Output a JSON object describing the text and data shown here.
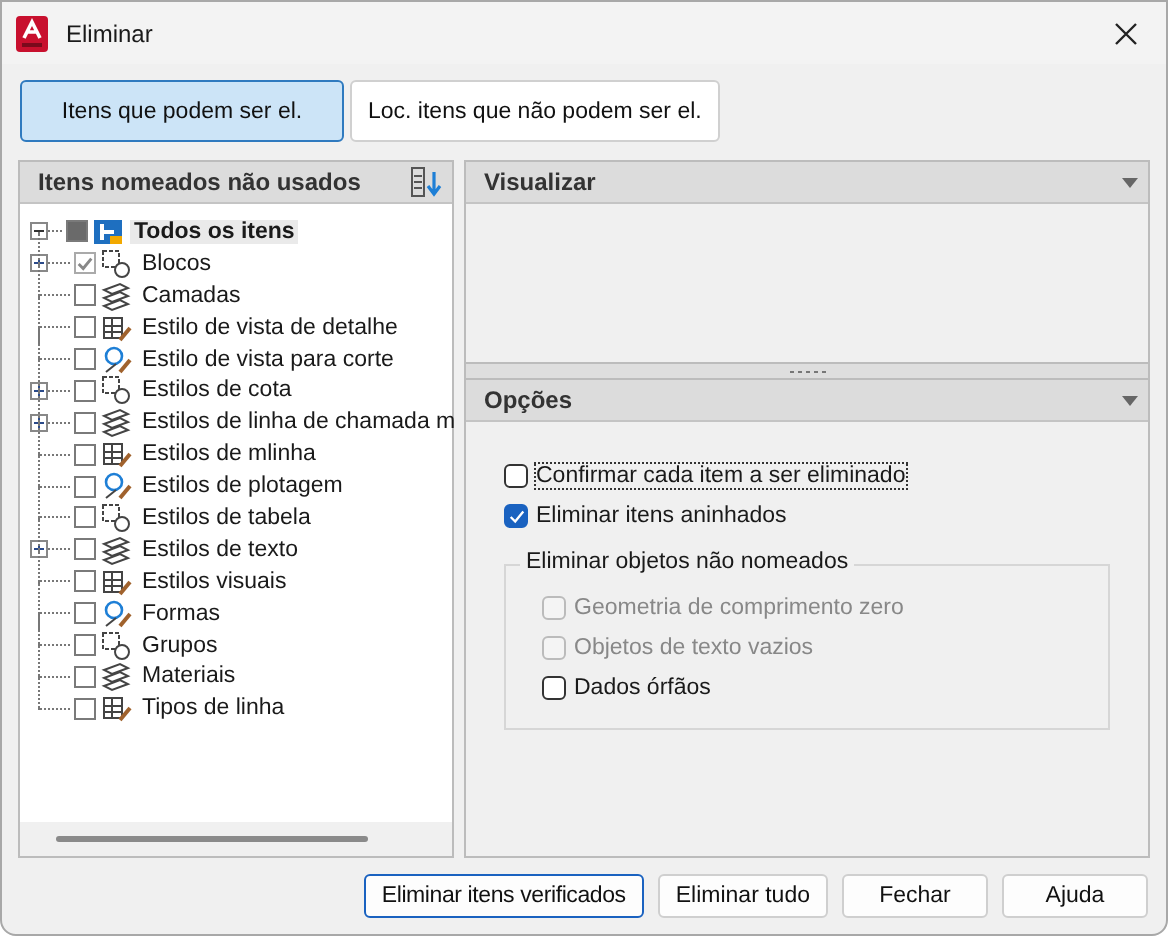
{
  "window": {
    "title": "Eliminar"
  },
  "tabs": [
    {
      "label": "Itens que podem ser el.",
      "selected": true
    },
    {
      "label": "Loc. itens que não podem ser el.",
      "selected": false
    }
  ],
  "tree": {
    "title": "Itens nomeados não usados",
    "root": {
      "label": "Todos os itens",
      "expanded": true,
      "indeterminate": true,
      "selected": true,
      "children": [
        {
          "label": "Blocos",
          "selected": false,
          "checked": true,
          "disabled": true,
          "expandable": true
        },
        {
          "label": "Camadas",
          "selected": false,
          "checked": false,
          "disabled": false,
          "expandable": false
        },
        {
          "label": "Estilo de vista de detalhe",
          "selected": false,
          "checked": false,
          "disabled": false,
          "expandable": false
        },
        {
          "label": "Estilo de vista para corte",
          "selected": false,
          "checked": false,
          "disabled": false,
          "expandable": false
        },
        {
          "label": "Estilos de cota",
          "selected": false,
          "checked": false,
          "disabled": false,
          "expandable": true
        },
        {
          "label": "Estilos de linha de chamada m",
          "selected": false,
          "checked": false,
          "disabled": false,
          "expandable": true
        },
        {
          "label": "Estilos de mlinha",
          "selected": false,
          "checked": false,
          "disabled": false,
          "expandable": false
        },
        {
          "label": "Estilos de plotagem",
          "selected": false,
          "checked": false,
          "disabled": false,
          "expandable": false
        },
        {
          "label": "Estilos de tabela",
          "selected": false,
          "checked": false,
          "disabled": false,
          "expandable": false
        },
        {
          "label": "Estilos de texto",
          "selected": false,
          "checked": false,
          "disabled": false,
          "expandable": true
        },
        {
          "label": "Estilos visuais",
          "selected": false,
          "checked": false,
          "disabled": false,
          "expandable": false
        },
        {
          "label": "Formas",
          "selected": false,
          "checked": false,
          "disabled": false,
          "expandable": false
        },
        {
          "label": "Grupos",
          "selected": false,
          "checked": false,
          "disabled": false,
          "expandable": false
        },
        {
          "label": "Materiais",
          "selected": false,
          "checked": false,
          "disabled": false,
          "expandable": false
        },
        {
          "label": "Tipos de linha",
          "selected": false,
          "checked": false,
          "disabled": false,
          "expandable": false
        }
      ]
    }
  },
  "preview": {
    "title": "Visualizar",
    "expanded": true
  },
  "options": {
    "title": "Opções",
    "expanded": true,
    "items": [
      {
        "label": "Confirmar cada item a ser eliminado",
        "checked": false,
        "disabled": false
      },
      {
        "label": "Eliminar itens aninhados",
        "checked": true,
        "disabled": false
      }
    ],
    "group": {
      "title": "Eliminar objetos não nomeados",
      "items": [
        {
          "label": "Geometria de comprimento zero",
          "checked": false,
          "disabled": true
        },
        {
          "label": "Objetos de texto vazios",
          "checked": false,
          "disabled": true
        },
        {
          "label": "Dados órfãos",
          "checked": false,
          "disabled": false
        }
      ]
    }
  },
  "buttons": [
    {
      "label": "Eliminar itens verificados",
      "default": true
    },
    {
      "label": "Eliminar tudo",
      "default": false
    },
    {
      "label": "Fechar",
      "default": false
    },
    {
      "label": "Ajuda",
      "default": false
    }
  ]
}
